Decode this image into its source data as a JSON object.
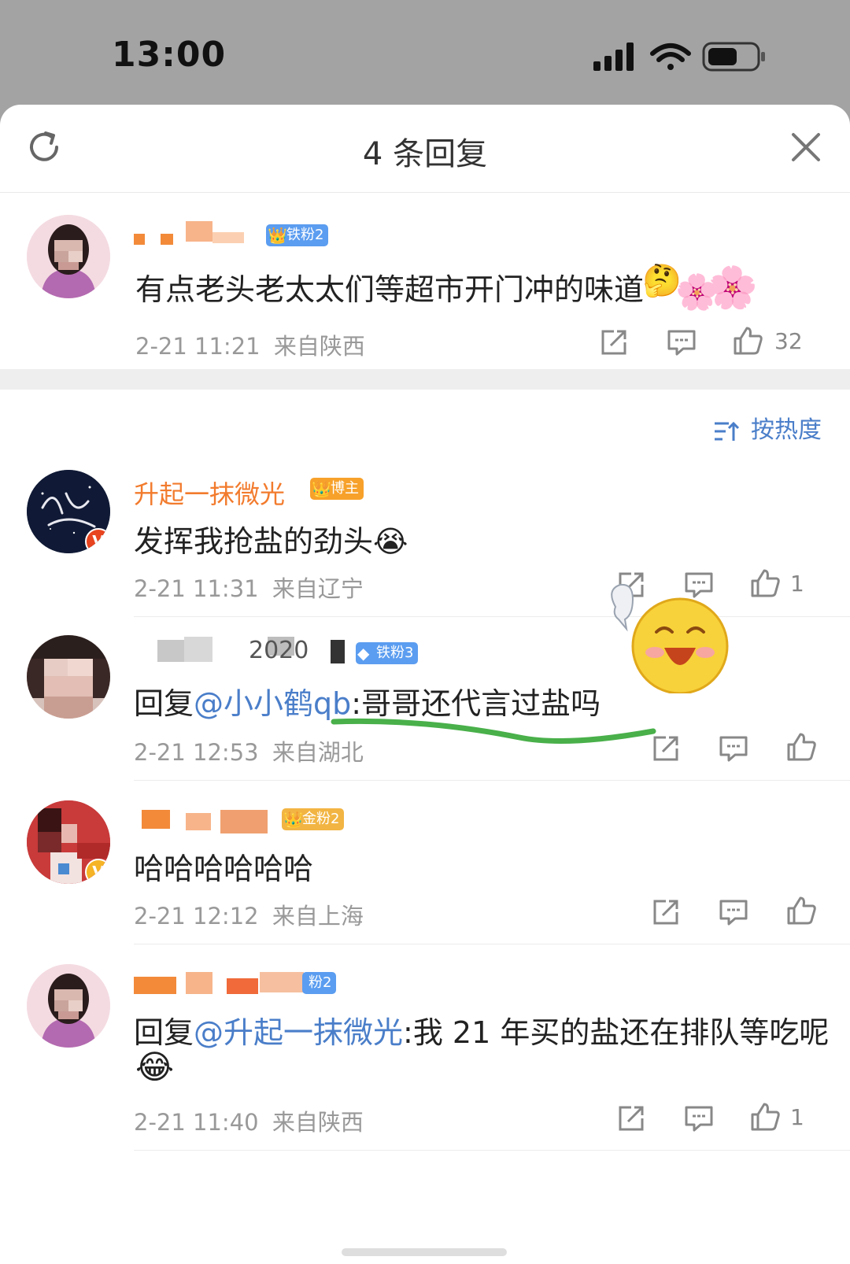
{
  "status_bar": {
    "time": "13:00"
  },
  "header": {
    "title": "4 条回复"
  },
  "root_comment": {
    "badge": "铁粉2",
    "text": "有点老头老太太们等超市开门冲的味道",
    "time": "2-21 11:21",
    "location": "来自陕西",
    "likes": "32"
  },
  "sort": {
    "label": "按热度"
  },
  "replies": [
    {
      "username": "升起一抹微光",
      "badge": "博主",
      "text": "发挥我抢盐的劲头",
      "time": "2-21 11:31",
      "location": "来自辽宁",
      "likes": "1"
    },
    {
      "username_fragment": "2020",
      "badge": "铁粉3",
      "reply_prefix": "回复",
      "mention": "@小小鹤qb",
      "text": ":哥哥还代言过盐吗",
      "time": "2-21 12:53",
      "location": "来自湖北",
      "likes": ""
    },
    {
      "badge": "金粉2",
      "text": "哈哈哈哈哈哈",
      "time": "2-21 12:12",
      "location": "来自上海",
      "likes": ""
    },
    {
      "badge": "粉2",
      "reply_prefix": "回复",
      "mention": "@升起一抹微光",
      "text": ":我 21 年买的盐还在排队等吃呢",
      "time": "2-21 11:40",
      "location": "来自陕西",
      "likes": "1"
    }
  ],
  "colors": {
    "link_blue": "#4a7ec9",
    "blogger_name": "#f27b2d",
    "badge_blue": "#5b9df0",
    "badge_orange": "#f7a12a",
    "badge_gold": "#f2b543",
    "verified_red": "#e8441f",
    "verified_gold": "#f5b326",
    "annotation_green": "#49b04a"
  },
  "icons": [
    "refresh-icon",
    "close-icon",
    "share-icon",
    "comment-icon",
    "like-icon",
    "sort-icon",
    "signal-icon",
    "wifi-icon",
    "battery-icon"
  ]
}
